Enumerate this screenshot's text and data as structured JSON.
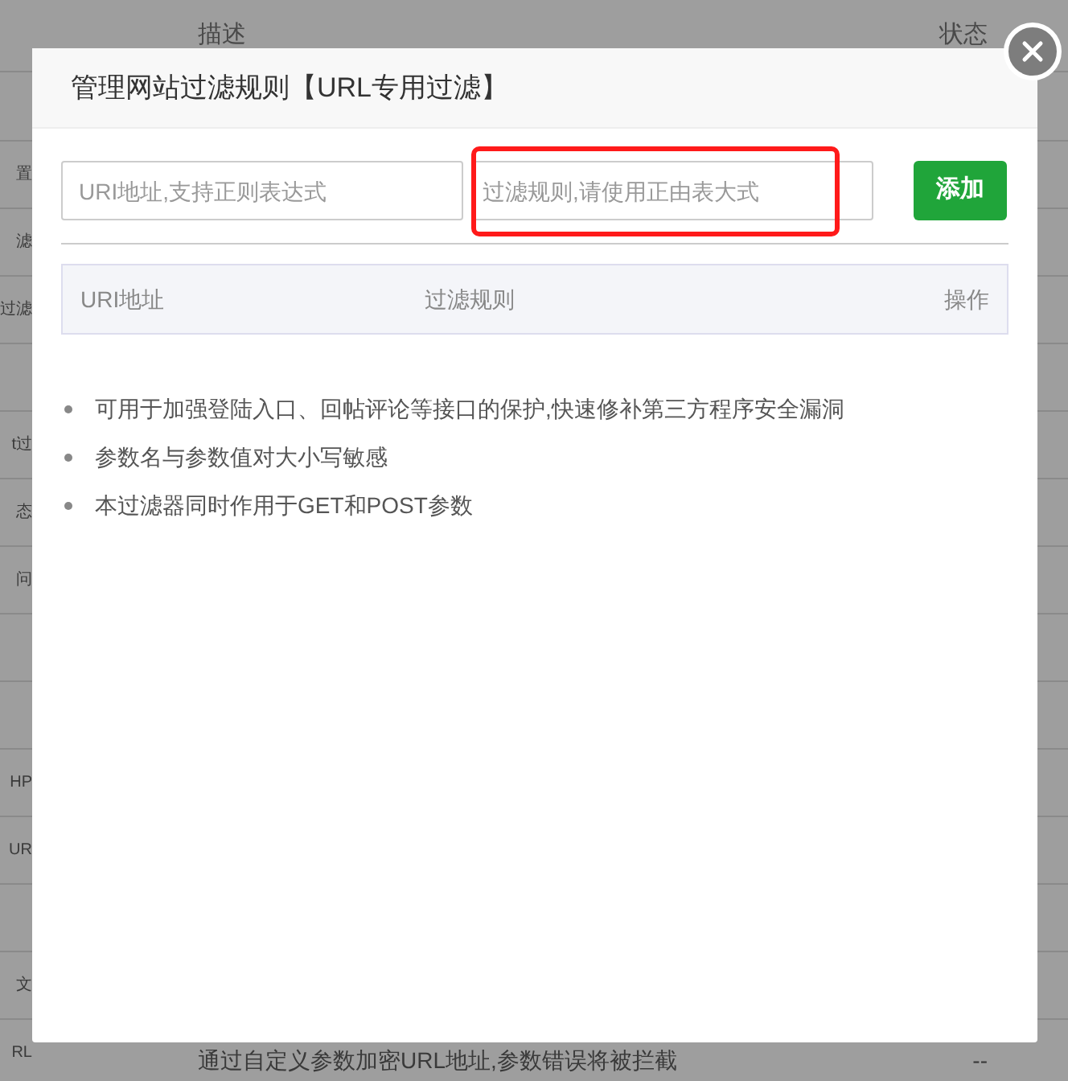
{
  "background_table": {
    "columns": [
      "描述",
      "状态"
    ],
    "rows": [
      {
        "column_1": "置"
      },
      {
        "column_1": "滤"
      },
      {
        "column_1": "过滤"
      },
      {
        "column_1": ""
      },
      {
        "column_1": "t过"
      },
      {
        "column_1": "态"
      },
      {
        "column_1": "问"
      },
      {
        "column_1": ""
      },
      {
        "column_1": ""
      },
      {
        "column_1": "HP"
      },
      {
        "column_1": "UR"
      },
      {
        "column_1": ""
      },
      {
        "column_1": "文"
      },
      {
        "column_1": "RL",
        "description": "通过自定义参数加密URL地址,参数错误将被拦截",
        "status": "--"
      }
    ]
  },
  "dialog": {
    "title": "管理网站过滤规则【URL专用过滤】",
    "uri_field": {
      "placeholder": "URI地址,支持正则表达式"
    },
    "rule_field": {
      "placeholder": "过滤规则,请使用正由表大式",
      "highlighted": true
    },
    "add_button": "添加",
    "table": {
      "columns": [
        "URI地址",
        "过滤规则",
        "操作"
      ]
    },
    "notes": [
      "可用于加强登陆入口、回帖评论等接口的保护,快速修补第三方程序安全漏洞",
      "参数名与参数值对大小写敏感",
      "本过滤器同时作用于GET和POST参数"
    ]
  }
}
